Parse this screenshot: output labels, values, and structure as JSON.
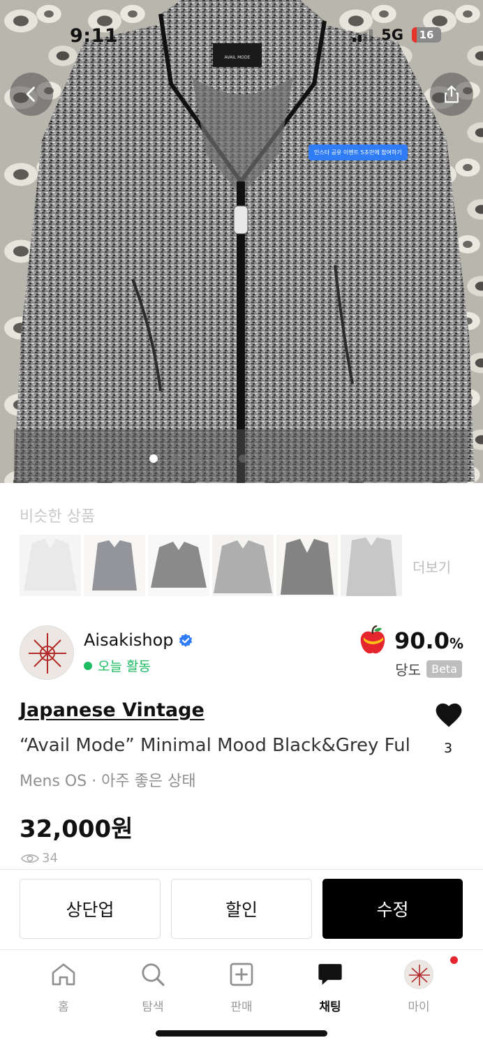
{
  "status_bar": {
    "time": "9:11",
    "network": "5G",
    "battery": "16"
  },
  "hero": {
    "promo_label": "인스타 공유 이벤트 5초만에 참여하기",
    "jacket_label": "AVAIL MODE",
    "slide_count": 6,
    "active_slide": 1
  },
  "similar": {
    "title": "비슷한 상품",
    "more_label": "더보기"
  },
  "seller": {
    "name": "Aisakishop",
    "activity": "오늘 활동",
    "score": "90.0",
    "score_unit": "%",
    "sweetness_label": "당도",
    "beta_label": "Beta"
  },
  "product": {
    "brand": "Japanese Vintage",
    "title": "“Avail Mode” Minimal Mood Black&Grey Ful",
    "meta": "Mens OS · 아주 좋은 상태",
    "price": "32,000원",
    "views": "34",
    "likes": "3"
  },
  "actions": {
    "bump_label": "상단업",
    "discount_label": "할인",
    "edit_label": "수정"
  },
  "tabs": [
    {
      "label": "홈",
      "icon": "home-icon"
    },
    {
      "label": "탐색",
      "icon": "search-icon"
    },
    {
      "label": "판매",
      "icon": "plus-square-icon"
    },
    {
      "label": "채팅",
      "icon": "chat-icon",
      "active": true
    },
    {
      "label": "마이",
      "icon": "profile-avatar",
      "badge": true
    }
  ],
  "colors": {
    "accent_green": "#1dbb62",
    "verified_blue": "#2f7cf6",
    "badge_red": "#e5262e"
  }
}
